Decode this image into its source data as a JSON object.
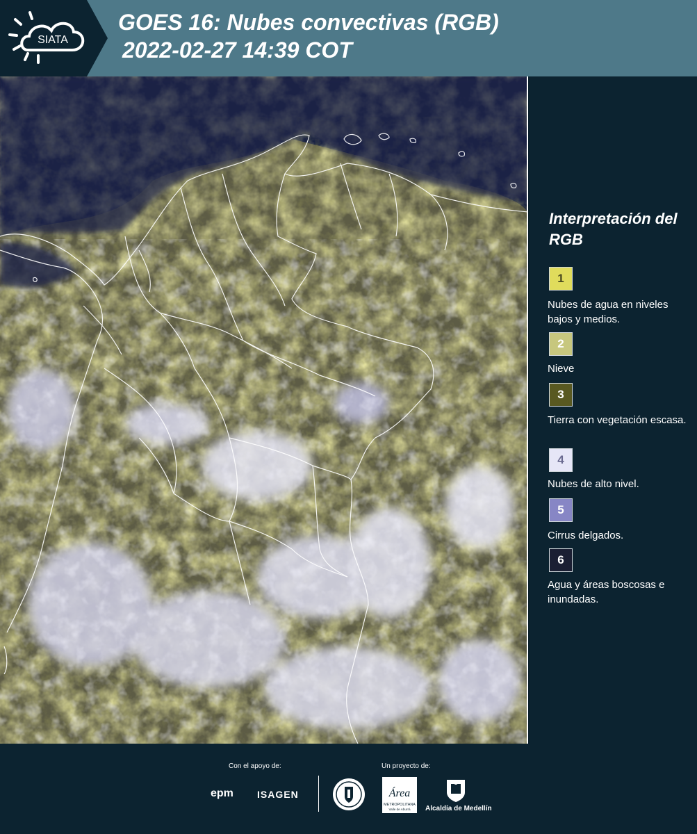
{
  "header": {
    "logo_text": "SIATA",
    "title_line1": "GOES 16: Nubes convectivas (RGB)",
    "title_line2": "2022-02-27 14:39 COT"
  },
  "legend": {
    "title": "Interpretación del RGB",
    "items": [
      {
        "num": "1",
        "label": "Nubes de agua en niveles bajos y medios.",
        "color": "#e0dc5c",
        "num_color": "#4a4a20"
      },
      {
        "num": "2",
        "label": "Nieve",
        "color": "#c7c77e",
        "num_color": "#ffffff"
      },
      {
        "num": "3",
        "label": "Tierra con vegetación escasa.",
        "color": "#595921",
        "num_color": "#ffffff"
      },
      {
        "num": "4",
        "label": "Nubes de alto nivel.",
        "color": "#e6e6f7",
        "num_color": "#6a6a90"
      },
      {
        "num": "5",
        "label": "Cirrus delgados.",
        "color": "#8786c5",
        "num_color": "#ffffff"
      },
      {
        "num": "6",
        "label": "Agua y áreas boscosas e inundadas.",
        "color": "#1b1f33",
        "num_color": "#ffffff"
      }
    ]
  },
  "footer": {
    "support_label": "Con el apoyo de:",
    "project_label": "Un proyecto de:",
    "sponsor1": "epm",
    "sponsor2": "ISAGEN",
    "partner_area_title": "Área",
    "partner_area_subtitle": "METROPOLITANA",
    "partner_area_region": "Valle de Aburrá",
    "partner_city": "Alcaldía de Medellín"
  },
  "colors": {
    "header_bg": "#4e7989",
    "panel_bg": "#0c2330",
    "ocean": "#1a2342",
    "cloud_yellow": "#d9d55a",
    "cloud_high": "#e8e8f5",
    "border_lines": "#ffffff"
  }
}
